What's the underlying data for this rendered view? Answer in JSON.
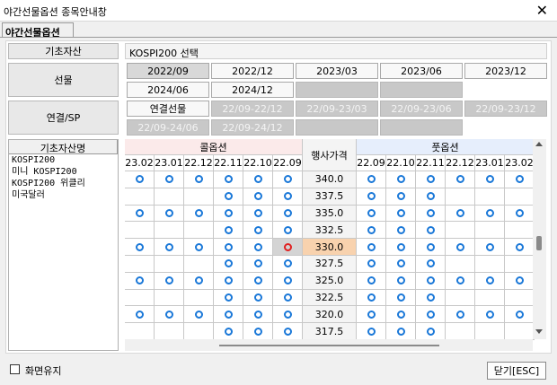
{
  "window": {
    "title": "야간선물옵션 종목안내창",
    "close_glyph": "✕"
  },
  "tab": {
    "label": "야간선물옵션"
  },
  "info": {
    "base_asset_label": "기초자산",
    "base_asset_value": "KOSPI200 선택",
    "futures_label": "선물",
    "spread_label": "연결/SP"
  },
  "futures": [
    {
      "label": "2022/09",
      "state": "sel"
    },
    {
      "label": "2022/12",
      "state": "norm"
    },
    {
      "label": "2023/03",
      "state": "norm"
    },
    {
      "label": "2023/06",
      "state": "norm"
    },
    {
      "label": "2023/12",
      "state": "norm"
    },
    {
      "label": "2024/06",
      "state": "norm"
    },
    {
      "label": "2024/12",
      "state": "norm"
    },
    {
      "label": "",
      "state": "empty"
    },
    {
      "label": "",
      "state": "empty"
    }
  ],
  "spreads": [
    {
      "label": "연결선물",
      "state": "norm"
    },
    {
      "label": "22/09-22/12",
      "state": "dis"
    },
    {
      "label": "22/09-23/03",
      "state": "dis"
    },
    {
      "label": "22/09-23/06",
      "state": "dis"
    },
    {
      "label": "22/09-23/12",
      "state": "dis"
    },
    {
      "label": "22/09-24/06",
      "state": "dis"
    },
    {
      "label": "22/09-24/12",
      "state": "dis"
    },
    {
      "label": "",
      "state": "empty"
    },
    {
      "label": "",
      "state": "empty"
    }
  ],
  "asset_list": {
    "header": "기초자산명",
    "items": [
      "KOSPI200",
      "미니 KOSPI200",
      "KOSPI200 위클리",
      "미국달러"
    ]
  },
  "options": {
    "call_header": "콜옵션",
    "put_header": "풋옵션",
    "strike_header": "행사가격",
    "call_months": [
      "23.02",
      "23.01",
      "22.12",
      "22.11",
      "22.10",
      "22.09"
    ],
    "put_months": [
      "22.09",
      "22.10",
      "22.11",
      "22.12",
      "23.01",
      "23.02"
    ],
    "rows": [
      {
        "strike": "340.0",
        "call": [
          1,
          1,
          1,
          1,
          1,
          1
        ],
        "put": [
          1,
          1,
          1,
          1,
          1,
          1
        ]
      },
      {
        "strike": "337.5",
        "call": [
          0,
          0,
          0,
          1,
          1,
          1
        ],
        "put": [
          1,
          1,
          1,
          0,
          0,
          0
        ]
      },
      {
        "strike": "335.0",
        "call": [
          1,
          1,
          1,
          1,
          1,
          1
        ],
        "put": [
          1,
          1,
          1,
          1,
          1,
          1
        ]
      },
      {
        "strike": "332.5",
        "call": [
          0,
          0,
          0,
          1,
          1,
          1
        ],
        "put": [
          1,
          1,
          1,
          0,
          0,
          0
        ]
      },
      {
        "strike": "330.0",
        "call": [
          1,
          1,
          1,
          1,
          1,
          2
        ],
        "put": [
          1,
          1,
          1,
          1,
          1,
          1
        ],
        "atm": true
      },
      {
        "strike": "327.5",
        "call": [
          0,
          0,
          0,
          1,
          1,
          1
        ],
        "put": [
          1,
          1,
          1,
          0,
          0,
          0
        ]
      },
      {
        "strike": "325.0",
        "call": [
          1,
          1,
          1,
          1,
          1,
          1
        ],
        "put": [
          1,
          1,
          1,
          1,
          1,
          1
        ]
      },
      {
        "strike": "322.5",
        "call": [
          0,
          0,
          0,
          1,
          1,
          1
        ],
        "put": [
          1,
          1,
          1,
          0,
          0,
          0
        ]
      },
      {
        "strike": "320.0",
        "call": [
          1,
          1,
          1,
          1,
          1,
          1
        ],
        "put": [
          1,
          1,
          1,
          1,
          1,
          1
        ]
      },
      {
        "strike": "317.5",
        "call": [
          0,
          0,
          0,
          1,
          1,
          1
        ],
        "put": [
          1,
          1,
          1,
          0,
          0,
          0
        ]
      }
    ]
  },
  "footer": {
    "keep_screen_label": "화면유지",
    "close_label": "닫기[ESC]"
  },
  "colors": {
    "call_header_bg": "#fbeaea",
    "put_header_bg": "#e6eefc",
    "circle": "#1a78d8",
    "atm_circle": "#e02020",
    "atm_strike_bg": "#f8d2ae"
  }
}
